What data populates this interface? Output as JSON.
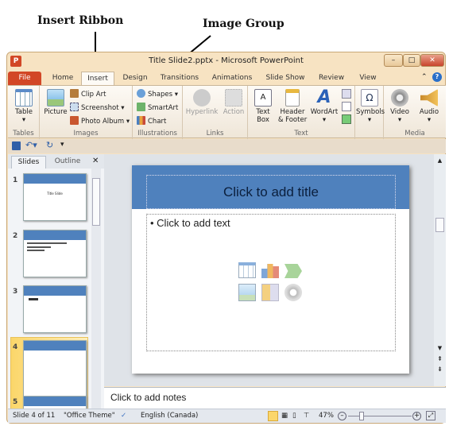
{
  "annotations": {
    "insert_ribbon": "Insert Ribbon",
    "image_group": "Image Group"
  },
  "window": {
    "title": "Title Slide2.pptx - Microsoft PowerPoint",
    "app_icon": "P"
  },
  "tabs": [
    "File",
    "Home",
    "Insert",
    "Design",
    "Transitions",
    "Animations",
    "Slide Show",
    "Review",
    "View"
  ],
  "active_tab": "Insert",
  "ribbon": {
    "tables": {
      "label": "Tables",
      "table": "Table"
    },
    "images": {
      "label": "Images",
      "picture": "Picture",
      "clip_art": "Clip Art",
      "screenshot": "Screenshot",
      "photo_album": "Photo Album"
    },
    "illustrations": {
      "label": "Illustrations",
      "shapes": "Shapes",
      "smartart": "SmartArt",
      "chart": "Chart"
    },
    "links": {
      "label": "Links",
      "hyperlink": "Hyperlink",
      "action": "Action"
    },
    "text": {
      "label": "Text",
      "text_box": "Text Box",
      "header_footer": "Header & Footer",
      "wordart": "WordArt"
    },
    "symbols": {
      "symbols": "Symbols"
    },
    "media": {
      "label": "Media",
      "video": "Video",
      "audio": "Audio"
    }
  },
  "pane_tabs": {
    "slides": "Slides",
    "outline": "Outline"
  },
  "thumbnails": [
    {
      "num": "1",
      "text": "Title Slide"
    },
    {
      "num": "2",
      "text": ""
    },
    {
      "num": "3",
      "text": ""
    },
    {
      "num": "4",
      "text": ""
    },
    {
      "num": "5",
      "text": ""
    }
  ],
  "selected_slide": 4,
  "slide": {
    "title": "Click to add title",
    "body": "Click to add text",
    "band_color": "#4f81bd"
  },
  "notes": "Click to add notes",
  "status": {
    "slide": "Slide 4 of 11",
    "theme": "\"Office Theme\"",
    "language": "English (Canada)",
    "zoom": "47%"
  },
  "zoom_level_percent": 47
}
